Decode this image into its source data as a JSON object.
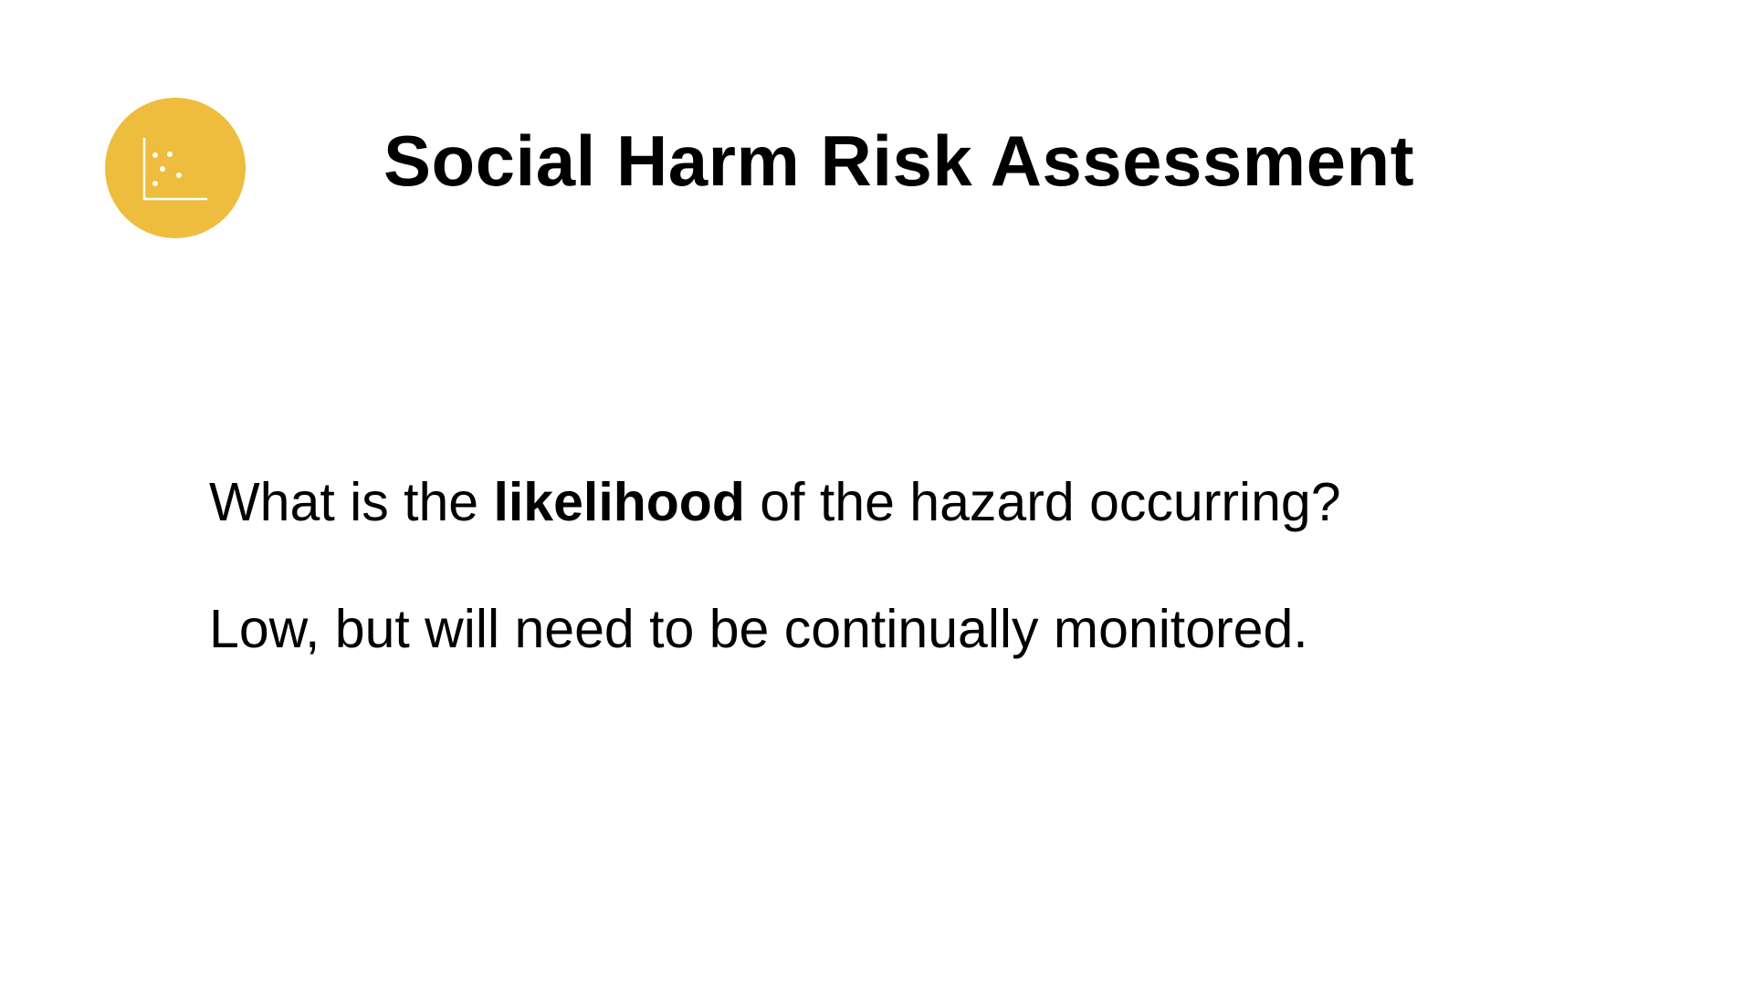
{
  "slide": {
    "title": "Social Harm Risk Assessment",
    "badge": {
      "icon": "scatter-plot-icon",
      "color": "#eebd3d",
      "icon_color": "#ffffff"
    },
    "question": {
      "before": "What is the ",
      "emphasis": "likelihood",
      "after": " of the hazard occurring?"
    },
    "answer": "Low, but will need to be continually monitored."
  }
}
